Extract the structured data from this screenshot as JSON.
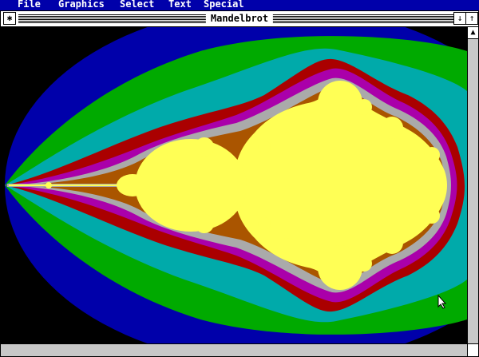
{
  "menu": {
    "items": [
      "File",
      "Graphics",
      "Select",
      "Text",
      "Special"
    ]
  },
  "window": {
    "title": "Mandelbrot",
    "close_icon": "✱",
    "scroll_down_icon": "↓",
    "scroll_up_icon": "↑"
  },
  "colors": {
    "menubar": "#0000aa",
    "black": "#000000",
    "blue": "#0000aa",
    "green": "#00aa00",
    "cyan": "#00aaaa",
    "red": "#aa0000",
    "magenta": "#aa00aa",
    "brown": "#aa5500",
    "gray": "#aaaaaa",
    "yellow": "#ffff55"
  }
}
